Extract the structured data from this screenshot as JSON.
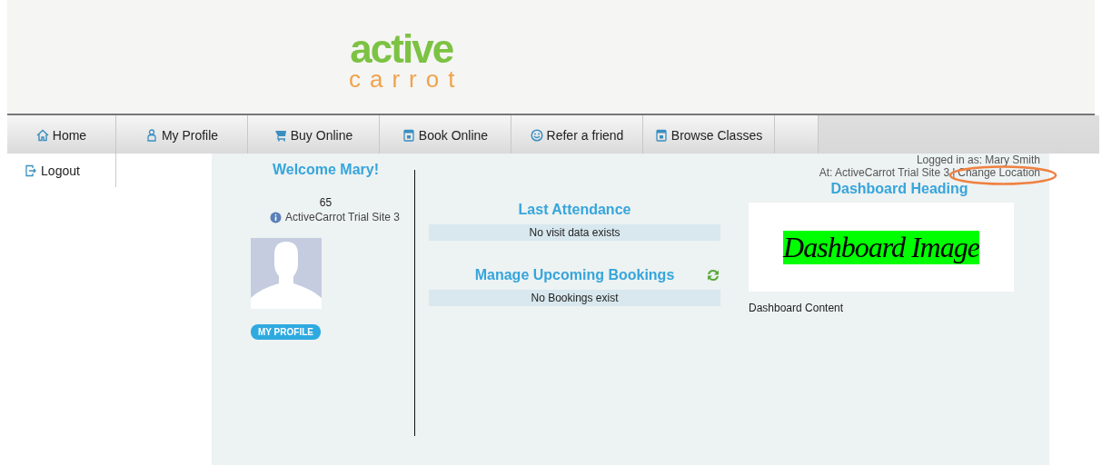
{
  "logo": {
    "top": "active",
    "bottom": "carrot"
  },
  "nav": [
    {
      "label": "Home",
      "kind": "home",
      "selected": false
    },
    {
      "label": "My Profile",
      "kind": "profile",
      "selected": false
    },
    {
      "label": "Buy Online",
      "kind": "cart",
      "selected": false
    },
    {
      "label": "Book Online",
      "kind": "calendar",
      "selected": false
    },
    {
      "label": "Refer a friend",
      "kind": "smiley",
      "selected": false
    },
    {
      "label": "Browse Classes",
      "kind": "calendar",
      "selected": false
    }
  ],
  "side_menu": [
    {
      "label": "Logout",
      "kind": "logout"
    }
  ],
  "user": {
    "logged_in": "Logged in as: Mary Smith",
    "site": "At: ActiveCarrot Trial Site 3",
    "separator": "|",
    "change_location": "Change Location"
  },
  "profile": {
    "welcome": "Welcome Mary!",
    "number": "65",
    "site": "ActiveCarrot Trial Site 3",
    "button": "MY PROFILE"
  },
  "sections": [
    {
      "title": "Last Attendance",
      "message": "No visit data exists",
      "refresh": false
    },
    {
      "title": "Manage Upcoming Bookings",
      "message": "No Bookings exist",
      "refresh": true
    }
  ],
  "dashboard": {
    "heading": "Dashboard Heading",
    "image_text": "Dashboard Image",
    "content": "Dashboard Content"
  }
}
